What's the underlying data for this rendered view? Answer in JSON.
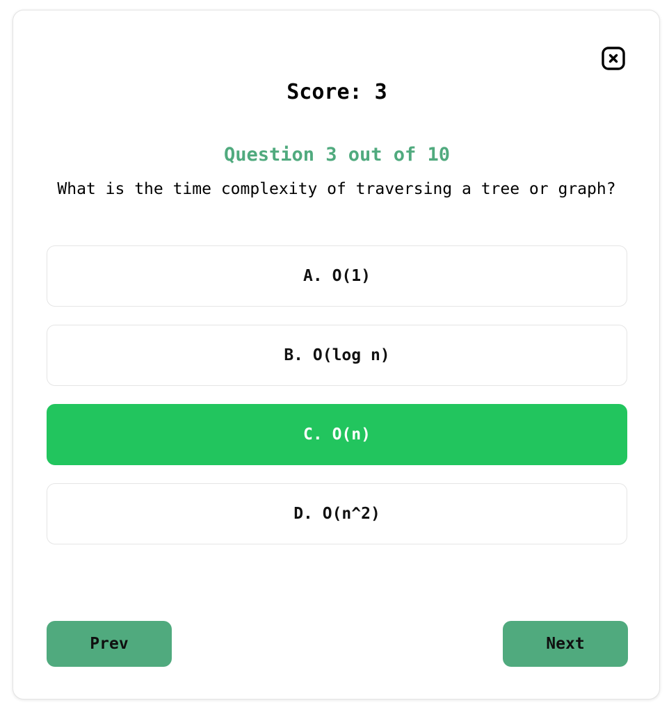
{
  "colors": {
    "accent": "#50aa7e",
    "selected": "#22c55e",
    "card_border": "#e3e3e3"
  },
  "header": {
    "close_icon": "close-square-icon",
    "score_text": "Score: 3"
  },
  "question": {
    "counter_text": "Question 3 out of 10",
    "text": "What is the time complexity of traversing a tree or graph?"
  },
  "options": [
    {
      "label": "A. O(1)",
      "selected": false
    },
    {
      "label": "B. O(log n)",
      "selected": false
    },
    {
      "label": "C. O(n)",
      "selected": true
    },
    {
      "label": "D. O(n^2)",
      "selected": false
    }
  ],
  "navigation": {
    "prev_label": "Prev",
    "next_label": "Next"
  }
}
